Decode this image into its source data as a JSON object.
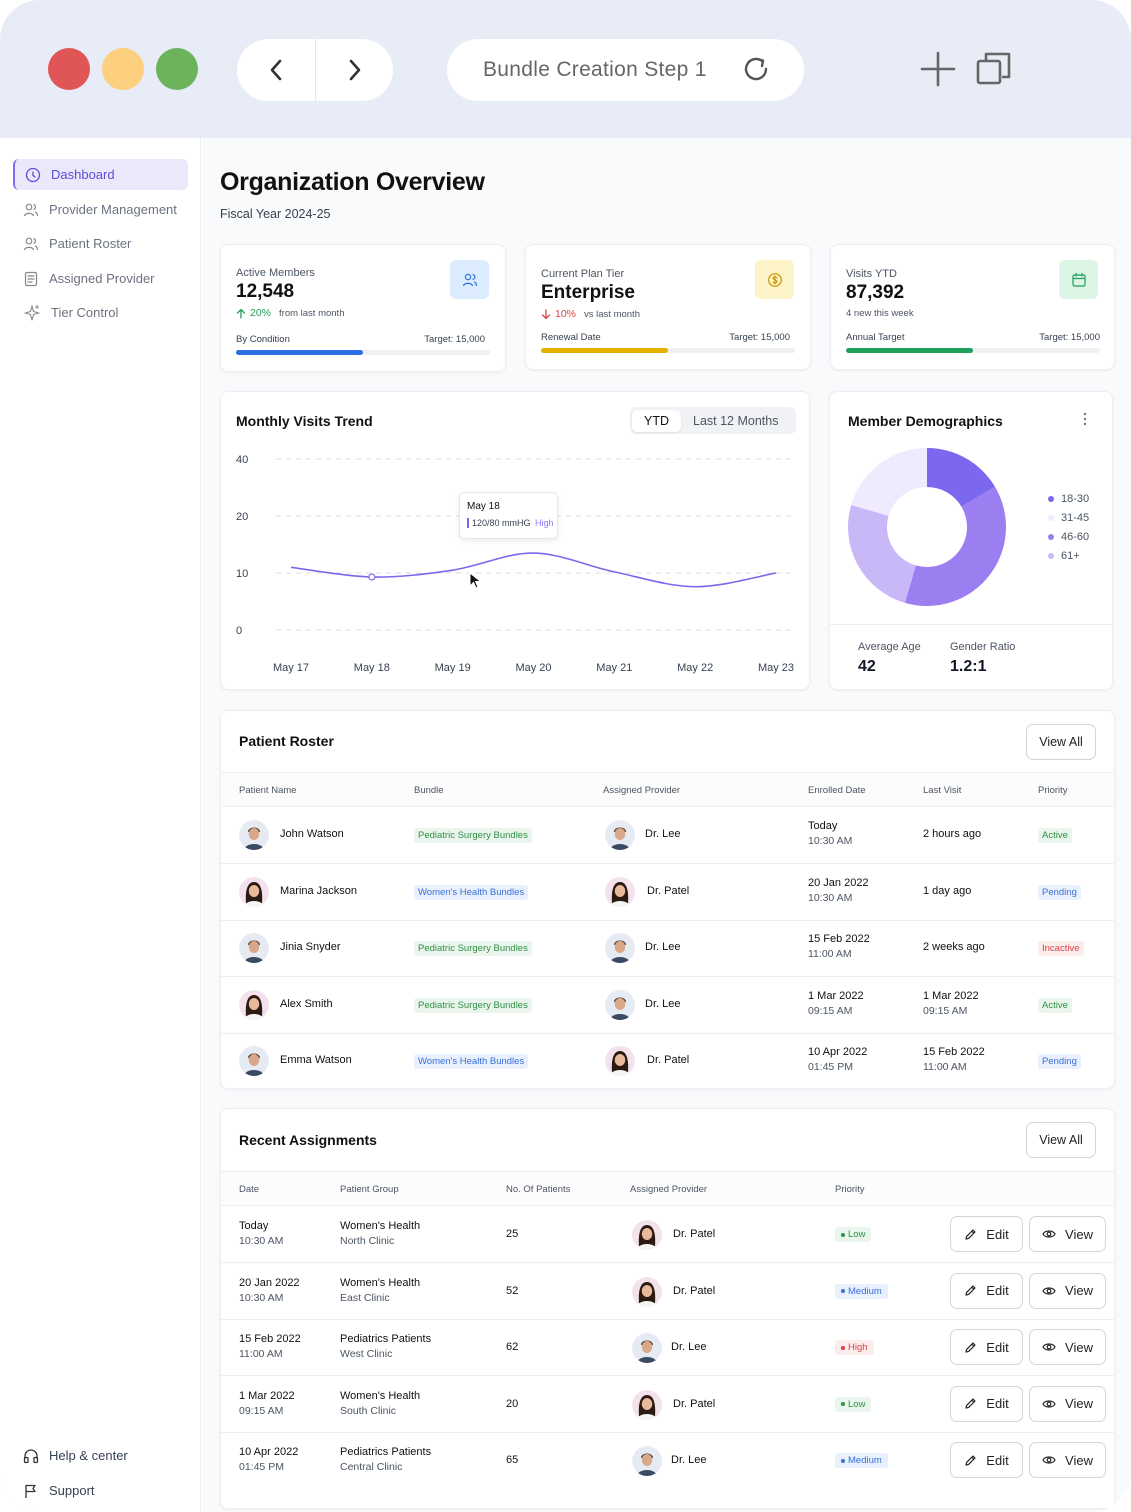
{
  "browser": {
    "url_title": "Bundle Creation Step 1"
  },
  "sidebar": {
    "items": [
      {
        "label": "Dashboard",
        "icon": "dashboard-icon",
        "active": true
      },
      {
        "label": "Provider Management",
        "icon": "users-icon"
      },
      {
        "label": "Patient Roster",
        "icon": "users-icon"
      },
      {
        "label": "Assigned Provider",
        "icon": "document-icon"
      },
      {
        "label": "Tier Control",
        "icon": "sparkle-icon"
      }
    ],
    "bottom": [
      {
        "label": "Help & center",
        "icon": "headphones-icon"
      },
      {
        "label": "Support",
        "icon": "flag-icon"
      }
    ]
  },
  "header": {
    "title": "Organization Overview",
    "subtitle": "Fiscal Year 2024-25"
  },
  "stats": [
    {
      "label": "Active Members",
      "value": "12,548",
      "change": "20%",
      "change_note": "from last month",
      "direction": "up",
      "bar_label": "By Condition",
      "target": "Target: 15,000",
      "progress": 0.5,
      "color": "#2b6fe0",
      "icon_bg": "#dcebfd",
      "icon": "users-icon"
    },
    {
      "label": "Current Plan Tier",
      "value": "Enterprise",
      "change": "10%",
      "change_note": "vs last month",
      "direction": "down",
      "bar_label": "Renewal Date",
      "target": "Target: 15,000",
      "progress": 0.5,
      "color": "#e6b000",
      "icon_bg": "#fcf3c6",
      "icon": "dollar-icon"
    },
    {
      "label": "Visits YTD",
      "value": "87,392",
      "change": "",
      "change_note": "4 new this week",
      "direction": "none",
      "bar_label": "Annual Target",
      "target": "Target: 15,000",
      "progress": 0.5,
      "color": "#1fa05a",
      "icon_bg": "#dcf5e4",
      "icon": "calendar-icon"
    }
  ],
  "trend": {
    "title": "Monthly Visits Trend",
    "toggle": [
      "YTD",
      "Last 12 Months"
    ],
    "tooltip": {
      "date": "May 18",
      "value": "120/80 mmHG",
      "level": "High"
    }
  },
  "chart_data": {
    "type": "line",
    "title": "Monthly Visits Trend",
    "x": [
      "May 17",
      "May 18",
      "May 19",
      "May 20",
      "May 21",
      "May 22",
      "May 23"
    ],
    "yticks": [
      0,
      10,
      20,
      40
    ],
    "series": [
      {
        "values": [
          11,
          9.3,
          10.5,
          13.5,
          10.2,
          7.6,
          10
        ]
      }
    ],
    "color": "#7b68ee"
  },
  "demographics": {
    "title": "Member Demographics",
    "legend": [
      "18-30",
      "31-45",
      "46-60",
      "61+"
    ],
    "stats": [
      {
        "label": "Average Age",
        "value": "42"
      },
      {
        "label": "Gender Ratio",
        "value": "1.2:1"
      }
    ]
  },
  "roster": {
    "title": "Patient Roster",
    "view_all": "View All",
    "columns": [
      "Patient Name",
      "Bundle",
      "Assigned Provider",
      "Enrolled Date",
      "Last Visit",
      "Priority"
    ],
    "rows": [
      {
        "name": "John Watson",
        "bundle": "Pediatric Surgery Bundles",
        "bundle_color": "green",
        "provider": "Dr. Lee",
        "enrolled": "Today",
        "enrolled_time": "10:30 AM",
        "last": "2 hours ago",
        "last_time": "",
        "status": "Active",
        "status_color": "green"
      },
      {
        "name": "Marina Jackson",
        "bundle": "Women's Health Bundles",
        "bundle_color": "blue",
        "provider": "Dr. Patel",
        "enrolled": "20 Jan 2022",
        "enrolled_time": "10:30 AM",
        "last": "1 day ago",
        "last_time": "",
        "status": "Pending",
        "status_color": "blue"
      },
      {
        "name": "Jinia Snyder",
        "bundle": "Pediatric Surgery Bundles",
        "bundle_color": "green",
        "provider": "Dr. Lee",
        "enrolled": "15 Feb 2022",
        "enrolled_time": "11:00 AM",
        "last": "2 weeks ago",
        "last_time": "",
        "status": "Incactive",
        "status_color": "red"
      },
      {
        "name": "Alex Smith",
        "bundle": "Pediatric Surgery Bundles",
        "bundle_color": "green",
        "provider": "Dr. Lee",
        "enrolled": "1 Mar 2022",
        "enrolled_time": "09:15 AM",
        "last": "1 Mar 2022",
        "last_time": "09:15 AM",
        "status": "Active",
        "status_color": "green"
      },
      {
        "name": "Emma Watson",
        "bundle": "Women's Health Bundles",
        "bundle_color": "blue",
        "provider": "Dr. Patel",
        "enrolled": "10 Apr 2022",
        "enrolled_time": "01:45 PM",
        "last": "15 Feb 2022",
        "last_time": "11:00 AM",
        "status": "Pending",
        "status_color": "blue"
      }
    ]
  },
  "assignments": {
    "title": "Recent Assignments",
    "view_all": "View All",
    "columns": [
      "Date",
      "Patient Group",
      "No. Of Patients",
      "Assigned Provider",
      "Priority"
    ],
    "edit_label": "Edit",
    "view_label": "View",
    "rows": [
      {
        "date": "Today",
        "time": "10:30 AM",
        "group": "Women's Health",
        "clinic": "North Clinic",
        "count": "25",
        "provider": "Dr. Patel",
        "priority": "Low",
        "priority_color": "green"
      },
      {
        "date": "20 Jan 2022",
        "time": "10:30 AM",
        "group": "Women's Health",
        "clinic": "East Clinic",
        "count": "52",
        "provider": "Dr. Patel",
        "priority": "Medium",
        "priority_color": "blue"
      },
      {
        "date": "15 Feb 2022",
        "time": "11:00 AM",
        "group": "Pediatrics Patients",
        "clinic": "West Clinic",
        "count": "62",
        "provider": "Dr. Lee",
        "priority": "High",
        "priority_color": "red"
      },
      {
        "date": "1 Mar 2022",
        "time": "09:15 AM",
        "group": "Women's Health",
        "clinic": "South Clinic",
        "count": "20",
        "provider": "Dr. Patel",
        "priority": "Low",
        "priority_color": "green"
      },
      {
        "date": "10 Apr 2022",
        "time": "01:45 PM",
        "group": "Pediatrics Patients",
        "clinic": "Central Clinic",
        "count": "65",
        "provider": "Dr. Lee",
        "priority": "Medium",
        "priority_color": "blue"
      }
    ]
  }
}
